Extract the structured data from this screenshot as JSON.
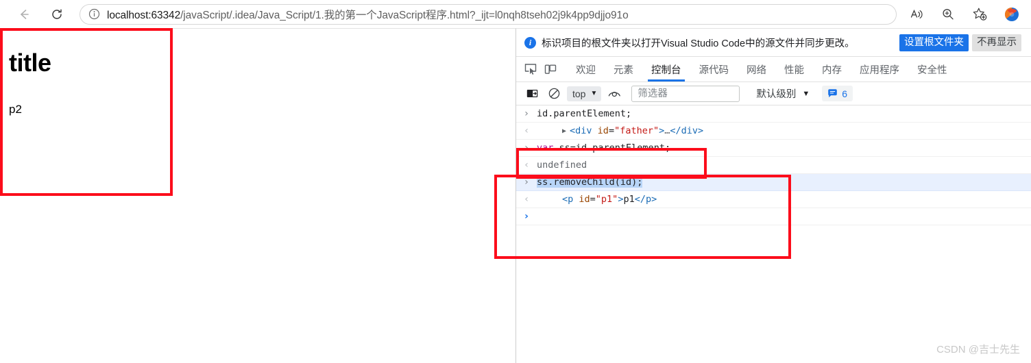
{
  "browser": {
    "back_label": "Back",
    "reload_label": "Refresh",
    "info_icon": "info-circle-icon",
    "url_host": "localhost:63342",
    "url_path": "/javaScript/.idea/Java_Script/1.我的第一个JavaScript程序.html?_ijt=l0nqh8tseh02j9k4pp9djjo91o",
    "toolbar_icons": [
      {
        "name": "read-aloud-icon",
        "label": "A"
      },
      {
        "name": "zoom-icon",
        "label": "Zoom"
      },
      {
        "name": "add-favorite-icon",
        "label": "Add to favorites"
      }
    ],
    "profile_icon": "browser-extension-icon"
  },
  "page": {
    "heading": "title",
    "paragraph": "p2"
  },
  "devtools": {
    "notification": {
      "icon": "info-icon",
      "icon_glyph": "i",
      "message": "标识项目的根文件夹以打开Visual Studio Code中的源文件并同步更改。",
      "primary_button": "设置根文件夹",
      "secondary_button": "不再显示"
    },
    "toolbar_icons": [
      {
        "name": "inspect-element-icon"
      },
      {
        "name": "device-toolbar-icon"
      }
    ],
    "tabs": [
      {
        "label": "欢迎",
        "active": false
      },
      {
        "label": "元素",
        "active": false
      },
      {
        "label": "控制台",
        "active": true
      },
      {
        "label": "源代码",
        "active": false
      },
      {
        "label": "网络",
        "active": false
      },
      {
        "label": "性能",
        "active": false
      },
      {
        "label": "内存",
        "active": false
      },
      {
        "label": "应用程序",
        "active": false
      },
      {
        "label": "安全性",
        "active": false
      }
    ],
    "console_toolbar": {
      "sidebar_icon": "console-sidebar-icon",
      "clear_icon": "clear-console-icon",
      "context_value": "top",
      "context_caret": "▼",
      "eye_icon": "live-expression-eye-icon",
      "filter_placeholder": "筛选器",
      "filter_value": "",
      "level_label": "默认级别",
      "level_caret": "▼",
      "message_badge_icon": "message-bubble-icon",
      "message_count": "6"
    },
    "console_log": [
      {
        "gutter": "›",
        "kind": "input",
        "text": "id.parentElement;",
        "selected": false
      },
      {
        "gutter": "‹",
        "kind": "output-element",
        "triangle": "▶",
        "tag_open": "<div",
        "attr_name": " id",
        "attr_eq": "=",
        "attr_value": "\"father\"",
        "tag_close_bracket": ">",
        "ellipsis": "…",
        "tag_end": "</div>",
        "selected": false
      },
      {
        "gutter": "›",
        "kind": "input-kw",
        "keyword": "var",
        "text": " ss=id.parentElement;",
        "selected": false
      },
      {
        "gutter": "‹",
        "kind": "output-plain",
        "text": "undefined",
        "selected": false
      },
      {
        "gutter": "›",
        "kind": "input-selected",
        "text": "ss.removeChild(id);",
        "selected": true
      },
      {
        "gutter": "‹",
        "kind": "output-element",
        "triangle": "",
        "tag_open": "<p",
        "attr_name": " id",
        "attr_eq": "=",
        "attr_value": "\"p1\"",
        "tag_close_bracket": ">",
        "ellipsis": "p1",
        "tag_end": "</p>",
        "selected": false
      },
      {
        "gutter": "›",
        "kind": "prompt",
        "text": "",
        "selected": false
      }
    ]
  },
  "annotations": [
    {
      "name": "page-highlight-box",
      "color": "#fc0d1b"
    },
    {
      "name": "console-var-highlight-box",
      "color": "#fc0d1b"
    },
    {
      "name": "console-remove-highlight-box",
      "color": "#fc0d1b"
    }
  ],
  "watermark": "CSDN @吉士先生"
}
